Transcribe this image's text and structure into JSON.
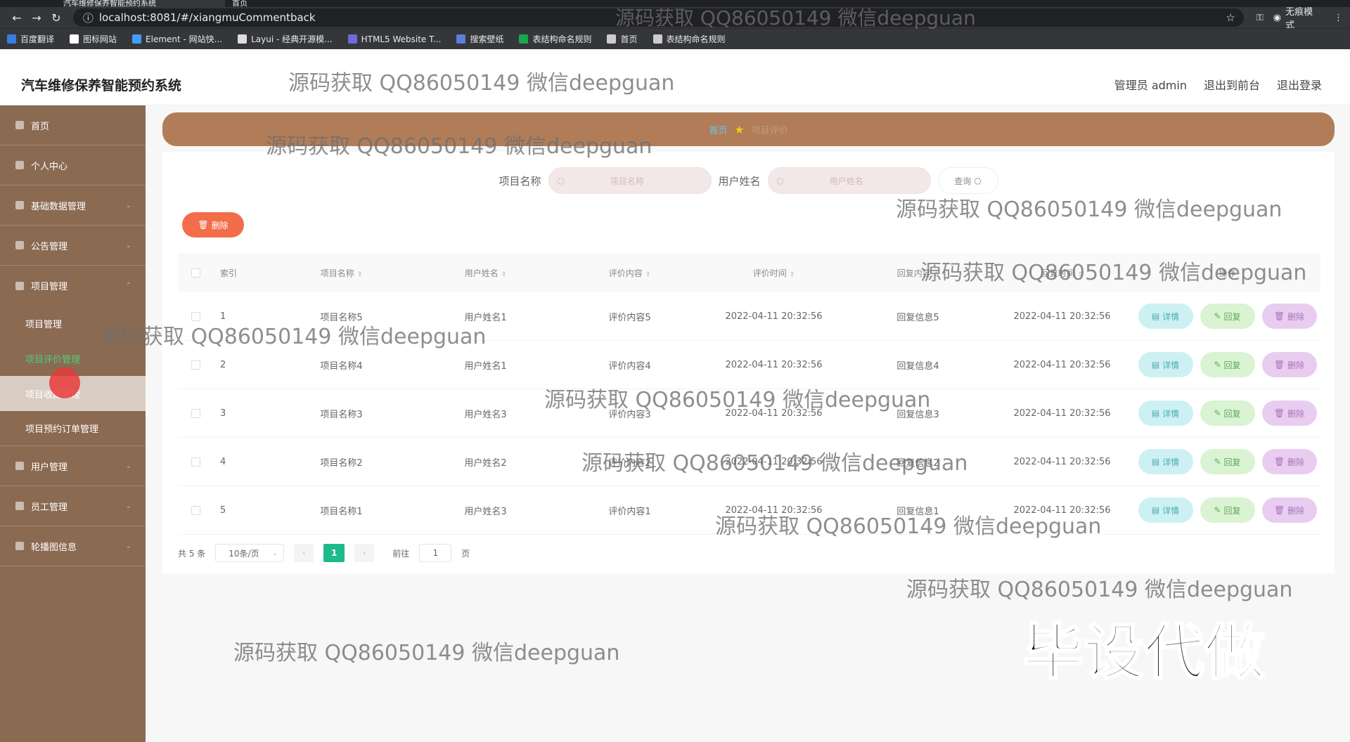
{
  "browser": {
    "tabs": [
      {
        "title": "汽车维修保养智能预约系统"
      },
      {
        "title": "首页"
      }
    ],
    "url": "localhost:8081/#/xiangmuCommentback",
    "incognito_label": "无痕模式",
    "bookmarks": [
      {
        "label": "百度翻译",
        "color": "#3b7bdf"
      },
      {
        "label": "图标网站",
        "color": "#ffffff"
      },
      {
        "label": "Element - 网站快...",
        "color": "#409eff"
      },
      {
        "label": "Layui - 经典开源模...",
        "color": "#dddddd"
      },
      {
        "label": "HTML5 Website T...",
        "color": "#6b6bd9"
      },
      {
        "label": "搜索壁纸",
        "color": "#5a7fd6"
      },
      {
        "label": "表结构命名规则",
        "color": "#1aa84e"
      },
      {
        "label": "首页",
        "color": "#cccccc"
      },
      {
        "label": "表结构命名规则",
        "color": "#cccccc"
      }
    ]
  },
  "header": {
    "title": "汽车维修保养智能预约系统",
    "admin": "管理员 admin",
    "to_front": "退出到前台",
    "logout": "退出登录"
  },
  "sidebar": {
    "items": [
      {
        "label": "首页"
      },
      {
        "label": "个人中心"
      },
      {
        "label": "基础数据管理"
      },
      {
        "label": "公告管理"
      },
      {
        "label": "项目管理"
      }
    ],
    "sub_items": [
      {
        "label": "项目管理"
      },
      {
        "label": "项目评价管理"
      },
      {
        "label": "项目收藏管理"
      },
      {
        "label": "项目预约订单管理"
      }
    ],
    "bottom_items": [
      {
        "label": "用户管理"
      },
      {
        "label": "员工管理"
      },
      {
        "label": "轮播图信息"
      }
    ]
  },
  "breadcrumb": {
    "home": "首页",
    "current": "项目评价"
  },
  "search": {
    "project_label": "项目名称",
    "project_placeholder": "项目名称",
    "user_label": "用户姓名",
    "user_placeholder": "用户姓名",
    "query_btn": "查询"
  },
  "toolbar": {
    "delete_label": "删除"
  },
  "table": {
    "headers": {
      "index": "索引",
      "name": "项目名称",
      "user": "用户姓名",
      "content": "评价内容",
      "time": "评价时间",
      "reply": "回复内容",
      "reply_time": "回复时间",
      "ops": "操作"
    },
    "op_labels": {
      "detail": "详情",
      "reply": "回复",
      "delete": "删除"
    },
    "rows": [
      {
        "index": "1",
        "name": "项目名称5",
        "user": "用户姓名1",
        "content": "评价内容5",
        "time": "2022-04-11 20:32:56",
        "reply": "回复信息5",
        "reply_time": "2022-04-11 20:32:56"
      },
      {
        "index": "2",
        "name": "项目名称4",
        "user": "用户姓名1",
        "content": "评价内容4",
        "time": "2022-04-11 20:32:56",
        "reply": "回复信息4",
        "reply_time": "2022-04-11 20:32:56"
      },
      {
        "index": "3",
        "name": "项目名称3",
        "user": "用户姓名3",
        "content": "评价内容3",
        "time": "2022-04-11 20:32:56",
        "reply": "回复信息3",
        "reply_time": "2022-04-11 20:32:56"
      },
      {
        "index": "4",
        "name": "项目名称2",
        "user": "用户姓名2",
        "content": "评价内容2",
        "time": "2022-04-11 20:32:56",
        "reply": "回复信息2",
        "reply_time": "2022-04-11 20:32:56"
      },
      {
        "index": "5",
        "name": "项目名称1",
        "user": "用户姓名3",
        "content": "评价内容1",
        "time": "2022-04-11 20:32:56",
        "reply": "回复信息1",
        "reply_time": "2022-04-11 20:32:56"
      }
    ]
  },
  "pager": {
    "total": "共 5 条",
    "page_size": "10条/页",
    "current_page": "1",
    "goto_label": "前往",
    "goto_value": "1",
    "page_unit": "页"
  },
  "watermark": "源码获取 QQ86050149 微信deepguan",
  "promo": "毕设代做",
  "colors": {
    "sidebar": "#8b6a52",
    "breadcrumb": "#b07d58",
    "accent": "#1dba8b",
    "danger": "#f36d4a"
  }
}
